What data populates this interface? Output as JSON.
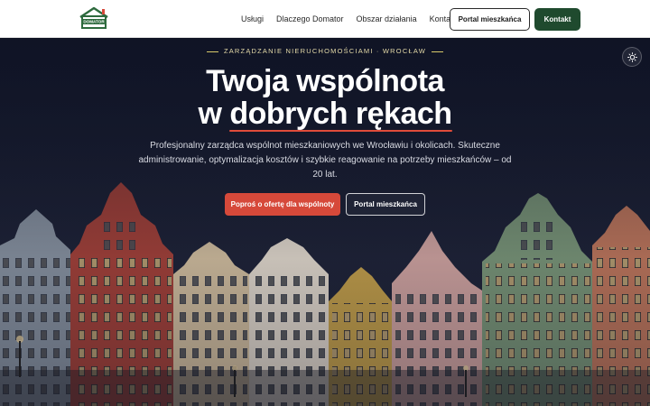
{
  "header": {
    "logo_text": "DOMATOR",
    "nav": [
      {
        "label": "Usługi"
      },
      {
        "label": "Dlaczego Domator"
      },
      {
        "label": "Obszar działania"
      },
      {
        "label": "Kontakt"
      }
    ],
    "portal_button": "Portal mieszkańca",
    "contact_button": "Kontakt"
  },
  "hero": {
    "eyebrow": "ZARZĄDZANIE NIERUCHOMOŚCIAMI · WROCŁAW",
    "title_line1": "Twoja wspólnota",
    "title_line2_prefix": "w ",
    "title_line2_highlight": "dobrych rękach",
    "description": "Profesjonalny zarządca wspólnot mieszkaniowych we Wrocławiu i okolicach. Skuteczne administrowanie, optymalizacja kosztów i szybkie reagowanie na potrzeby mieszkańców – od 20 lat.",
    "offer_button": "Poproś o ofertę dla wspólnoty",
    "portal_button": "Portal mieszkańca",
    "theme_toggle_icon": "sun-icon"
  },
  "colors": {
    "brand_green": "#1f4a2e",
    "accent_red": "#d6493a",
    "eyebrow_gold": "#d8c96a"
  }
}
